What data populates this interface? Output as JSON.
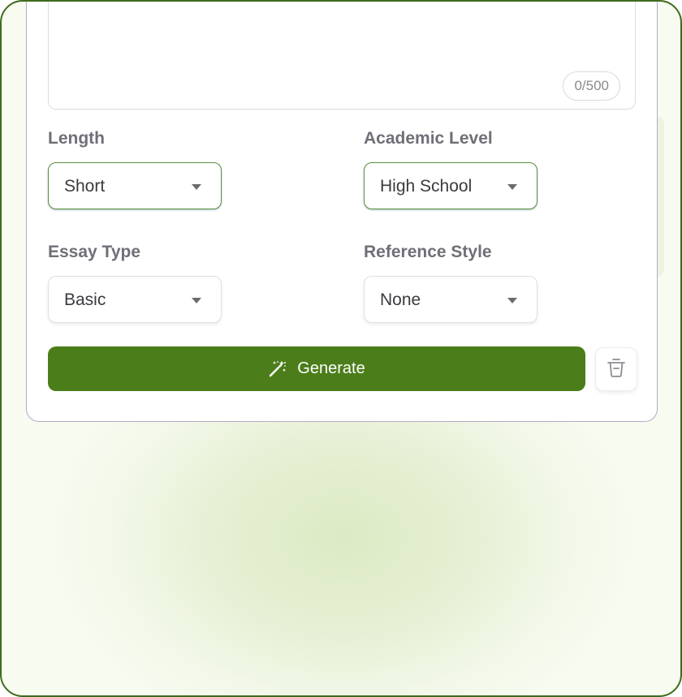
{
  "textarea": {
    "counter": "0/500"
  },
  "fields": [
    {
      "label": "Length",
      "value": "Short"
    },
    {
      "label": "Academic Level",
      "value": "High School"
    },
    {
      "label": "Essay Type",
      "value": "Basic"
    },
    {
      "label": "Reference Style",
      "value": "None"
    }
  ],
  "actions": {
    "generate_label": "Generate",
    "generate_icon": "magic-wand-icon",
    "delete_icon": "trash-icon"
  },
  "colors": {
    "primary": "#4b7d1a",
    "frame_border": "#3d6b1c",
    "card_border": "#b6aac6"
  }
}
